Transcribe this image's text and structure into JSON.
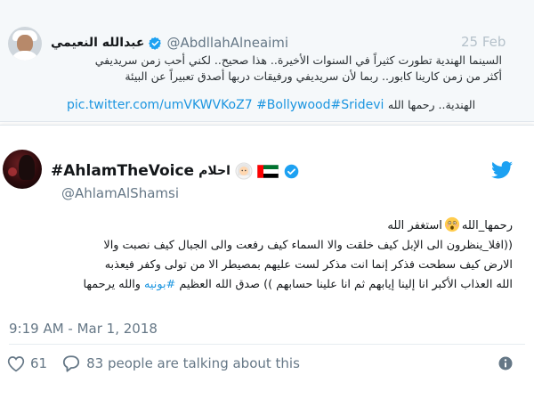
{
  "background_tweet": {
    "author_name": "عبدالله النعيمي",
    "handle": "@AbdllahAlneaimi",
    "date": "25 Feb",
    "lines": [
      "السينما الهندية تطورت كثيراً في السنوات الأخيرة.. هذا صحيح.. لكني أحب زمن سريديفي",
      "أكثر من زمن كارينا كابور.. ربما لأن سريديفي ورفيقات دربها أصدق تعبيراً عن البيئة",
      "الهندية.. رحمها الله"
    ],
    "link_text": "pic.twitter.com/umVKWVKoZ7 #Bollywood#Sridevi"
  },
  "tweet": {
    "display_name": "#AhlamTheVoice",
    "arabic_name": "احلام",
    "handle": "@AhlamAlShamsi",
    "line0_a": "رحمها_الله",
    "line0_b": "استغفر الله",
    "line1": "((افلا_ينظرون الى الإبل كيف خلقت والا السماء كيف رفعت والى الجبال كيف نصبت والا",
    "line2": "الارض كيف سطحت فذكر إنما انت مذكر لست عليهم بمصيطر الا من تولى وكفر فيعذبه",
    "line3_a": "الله العذاب الأكبر انا إلينا إيابهم ثم انا علينا حسابهم )) صدق الله العظيم",
    "line3_tag": "#بونيه",
    "line3_b": "والله يرحمها",
    "timestamp": "9:19 AM - Mar 1, 2018",
    "likes": "61",
    "talking": "83 people are talking about this"
  },
  "icons": {
    "verified": "verified-badge-icon",
    "bird": "twitter-bird-icon",
    "heart": "heart-icon",
    "reply": "speech-bubble-icon",
    "info": "info-icon",
    "emoji": "woman-emoji-icon",
    "flag": "uae-flag-icon",
    "scared": "scared-face-emoji-icon"
  },
  "colors": {
    "accent": "#1da1f2",
    "link": "#1b95e0",
    "muted": "#657786"
  }
}
